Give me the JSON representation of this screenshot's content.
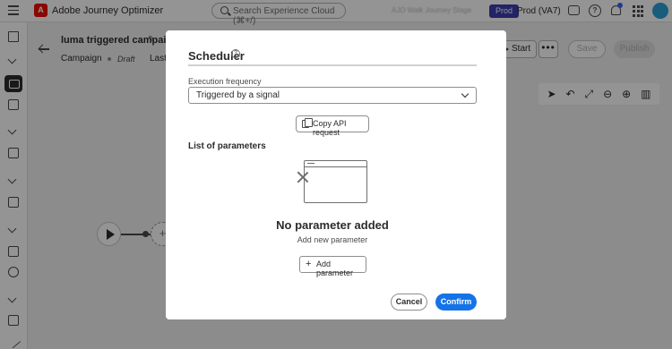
{
  "topbar": {
    "app_title": "Adobe Journey Optimizer",
    "logo_letter": "A",
    "search_placeholder": "Search Experience Cloud (⌘+/)",
    "org_name_blurred": "AJO Walk Journey Stage",
    "env_badge": "Prod",
    "env_name": "Prod (VA7)",
    "icons": [
      "hamburger-icon",
      "search-icon",
      "feedback-icon",
      "help-icon",
      "bell-icon",
      "apps-grid-icon",
      "avatar"
    ]
  },
  "page": {
    "campaign_title": "luma triggered campaign",
    "tab_campaign": "Campaign",
    "status": "Draft",
    "last_modified": "Last m",
    "start_label": "Start",
    "more_label": "•••",
    "save_label": "Save",
    "publish_label": "Publish"
  },
  "modal": {
    "title": "Scheduler",
    "frequency_label": "Execution frequency",
    "frequency_value": "Triggered by a signal",
    "copy_api_label": "Copy API request",
    "params_heading": "List of parameters",
    "empty_title": "No parameter added",
    "empty_subtitle": "Add new parameter",
    "add_param_label": "Add parameter",
    "cancel_label": "Cancel",
    "confirm_label": "Confirm"
  },
  "colors": {
    "accent": "#1473e6",
    "env_badge": "#3b3fae",
    "adobe_red": "#eb1000"
  }
}
